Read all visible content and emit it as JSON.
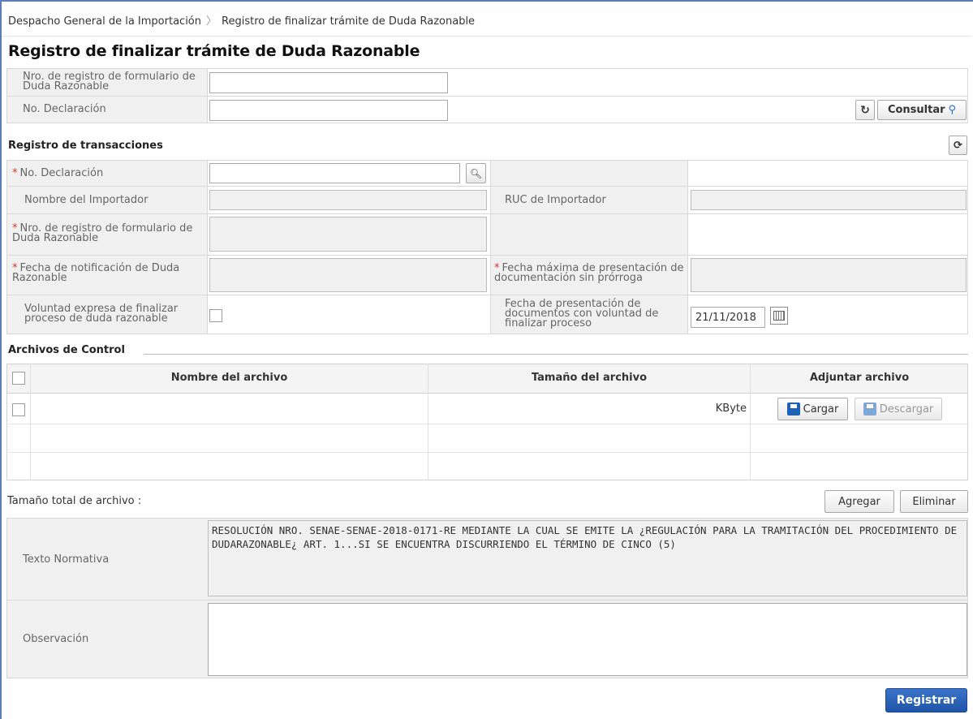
{
  "breadcrumb": {
    "root": "Despacho General de la Importación",
    "current": "Registro de finalizar trámite de Duda Razonable"
  },
  "page_title": "Registro de finalizar trámite de Duda Razonable",
  "search": {
    "form_number_label": "Nro. de registro de formulario de Duda Razonable",
    "form_number_value": "",
    "declaration_label": "No. Declaración",
    "declaration_value": "",
    "consult_label": "Consultar"
  },
  "transactions": {
    "title": "Registro de transacciones",
    "declaration_label": "No. Declaración",
    "declaration_value": "",
    "importer_name_label": "Nombre del Importador",
    "importer_name_value": "",
    "ruc_label": "RUC de Importador",
    "ruc_value": "",
    "form_number_label": "Nro. de registro de formulario de Duda Razonable",
    "form_number_value": "",
    "notification_date_label": "Fecha de notificación de Duda Razonable",
    "notification_date_value": "",
    "max_date_label": "Fecha máxima de presentación de documentación sin prórroga",
    "max_date_value": "",
    "express_will_label": "Voluntad expresa de finalizar proceso de duda razonable",
    "express_will_checked": false,
    "presentation_date_label": "Fecha de presentación de documentos con voluntad de finalizar proceso",
    "presentation_date_value": "21/11/2018"
  },
  "files": {
    "title": "Archivos de Control",
    "columns": [
      "Nombre del archivo",
      "Tamaño del archivo",
      "Adjuntar archivo"
    ],
    "row": {
      "name": "",
      "size_unit": "KByte",
      "upload_label": "Cargar",
      "download_label": "Descargar"
    },
    "total_label": "Tamaño total de archivo :",
    "add_label": "Agregar",
    "delete_label": "Eliminar"
  },
  "normative": {
    "label": "Texto Normativa",
    "text": "RESOLUCIÓN NRO. SENAE-SENAE-2018-0171-RE MEDIANTE LA CUAL SE EMITE LA ¿REGULACIÓN PARA LA TRAMITACIÓN DEL PROCEDIMIENTO DE DUDARAZONABLE¿ ART. 1...SI SE ENCUENTRA DISCURRIENDO EL TÉRMINO DE CINCO (5)"
  },
  "observation": {
    "label": "Observación",
    "value": ""
  },
  "register_label": "Registrar",
  "colors": {
    "accent": "#1f55a8",
    "required": "#e0302a",
    "frame": "#5b7fb5"
  }
}
